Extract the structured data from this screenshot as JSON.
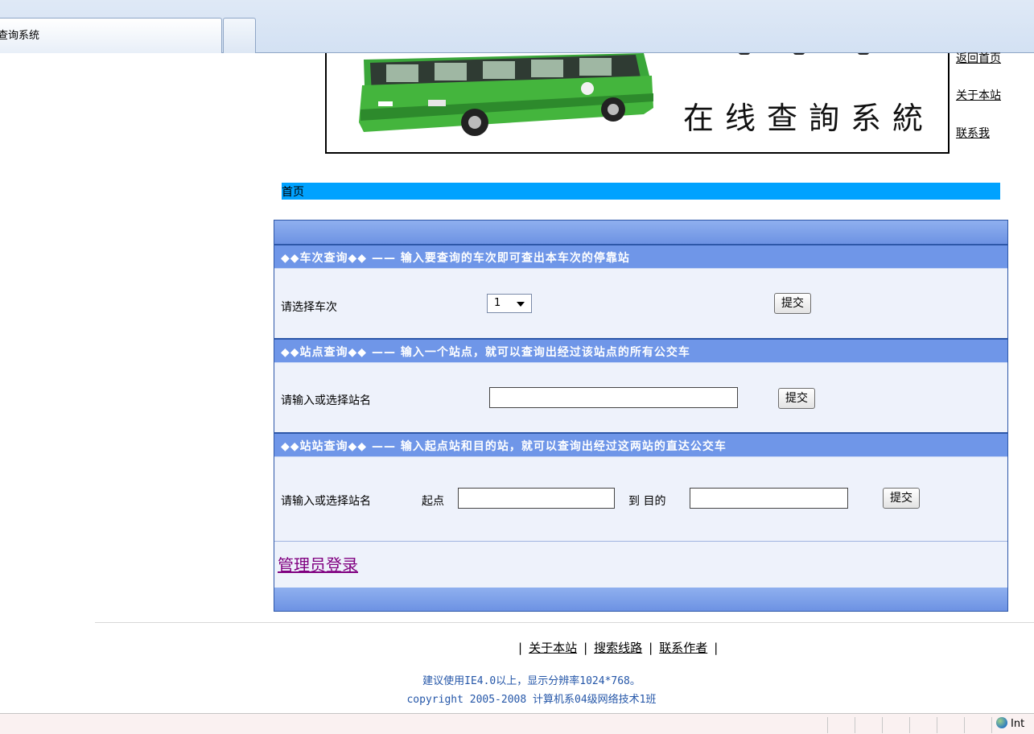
{
  "browser": {
    "active_tab_title": "查询系统",
    "status_zone": "Int"
  },
  "banner": {
    "title": "在线查詢系統"
  },
  "top_links": [
    "返回首页",
    "关于本站",
    "联系我"
  ],
  "breadcrumb": "首页",
  "sections": {
    "route": {
      "heading": "◆◆车次查询◆◆ —— 输入要查询的车次即可查出本车次的停靠站",
      "label": "请选择车次",
      "selected": "1",
      "submit": "提交"
    },
    "station": {
      "heading": "◆◆站点查询◆◆ —— 输入一个站点，就可以查询出经过该站点的所有公交车",
      "label": "请输入或选择站名",
      "value": "",
      "submit": "提交"
    },
    "transfer": {
      "heading": "◆◆站站查询◆◆ —— 输入起点站和目的站，就可以查询出经过这两站的直达公交车",
      "label": "请输入或选择站名",
      "from_label": "起点",
      "to_label": "到 目的",
      "from_value": "",
      "to_value": "",
      "submit": "提交"
    }
  },
  "admin_link": "管理员登录",
  "footer": {
    "links": [
      "关于本站",
      "搜索线路",
      "联系作者"
    ],
    "note1": "建议使用IE4.0以上，显示分辨率1024*768。",
    "note2": "copyright 2005-2008  计算机系04级网络技术1班"
  },
  "colors": {
    "breadcrumb_bg": "#00a2ff",
    "section_bar": "#6f96e8",
    "panel_border": "#2d57a8",
    "admin_link": "#800080",
    "footer_text": "#2456a8",
    "bus_body": "#3aa63a"
  }
}
